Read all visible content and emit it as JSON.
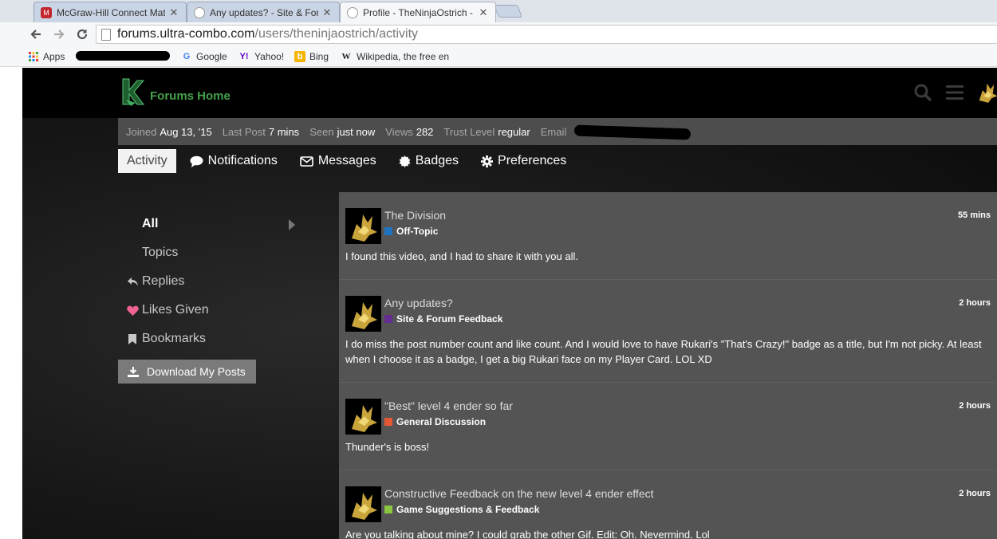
{
  "browser": {
    "tabs": [
      {
        "title": "McGraw-Hill Connect Mat",
        "favicon": "mcgraw-hill-icon",
        "active": false
      },
      {
        "title": "Any updates? - Site & For",
        "favicon": "discourse-icon",
        "active": false
      },
      {
        "title": "Profile - TheNinjaOstrich -",
        "favicon": "discourse-icon",
        "active": true
      }
    ],
    "url_host": "forums.ultra-combo.com",
    "url_path": "/users/theninjaostrich/activity",
    "bookmarks": [
      {
        "label": "Apps",
        "icon": "apps-grid-icon"
      },
      {
        "label": "Google",
        "icon": "google-icon"
      },
      {
        "label": "Yahoo!",
        "icon": "yahoo-icon"
      },
      {
        "label": "Bing",
        "icon": "bing-icon"
      },
      {
        "label": "Wikipedia, the free en",
        "icon": "wikipedia-icon"
      }
    ]
  },
  "site": {
    "home_label": "Forums Home",
    "brand_color": "#43a047"
  },
  "profile": {
    "stats": [
      {
        "label": "Joined",
        "value": "Aug 13, '15"
      },
      {
        "label": "Last Post",
        "value": "7 mins"
      },
      {
        "label": "Seen",
        "value": "just now"
      },
      {
        "label": "Views",
        "value": "282"
      },
      {
        "label": "Trust Level",
        "value": "regular"
      },
      {
        "label": "Email",
        "value": ""
      }
    ]
  },
  "nav_tabs": [
    {
      "label": "Activity",
      "icon": "",
      "active": true
    },
    {
      "label": "Notifications",
      "icon": "comment-icon",
      "active": false
    },
    {
      "label": "Messages",
      "icon": "envelope-icon",
      "active": false
    },
    {
      "label": "Badges",
      "icon": "certificate-icon",
      "active": false
    },
    {
      "label": "Preferences",
      "icon": "gear-icon",
      "active": false
    }
  ],
  "side_nav": [
    {
      "label": "All",
      "icon": "",
      "active": true
    },
    {
      "label": "Topics",
      "icon": "",
      "active": false
    },
    {
      "label": "Replies",
      "icon": "reply-icon",
      "active": false
    },
    {
      "label": "Likes Given",
      "icon": "heart-icon",
      "active": false
    },
    {
      "label": "Bookmarks",
      "icon": "bookmark-icon",
      "active": false
    }
  ],
  "download_label": "Download My Posts",
  "posts": [
    {
      "title": "The Division",
      "category": "Off-Topic",
      "category_color": "#1e73be",
      "time": "55 mins",
      "excerpt": "I found this video, and I had to share it with you all."
    },
    {
      "title": "Any updates?",
      "category": "Site & Forum Feedback",
      "category_color": "#652d90",
      "time": "2 hours",
      "excerpt": "I do miss the post number count and like count. And I would love to have Rukari's \"That's Crazy!\" badge as a title, but I'm not picky. At least when I choose it as a badge, I get a big Rukari face on my Player Card. LOL XD"
    },
    {
      "title": "\"Best\" level 4 ender so far",
      "category": "General Discussion",
      "category_color": "#e45735",
      "time": "2 hours",
      "excerpt": "Thunder's is boss!"
    },
    {
      "title": "Constructive Feedback on the new level 4 ender effect",
      "category": "Game Suggestions & Feedback",
      "category_color": "#8cc63f",
      "time": "2 hours",
      "excerpt": "Are you talking about mine? I could grab the other Gif. Edit: Oh. Nevermind. Lol"
    }
  ]
}
